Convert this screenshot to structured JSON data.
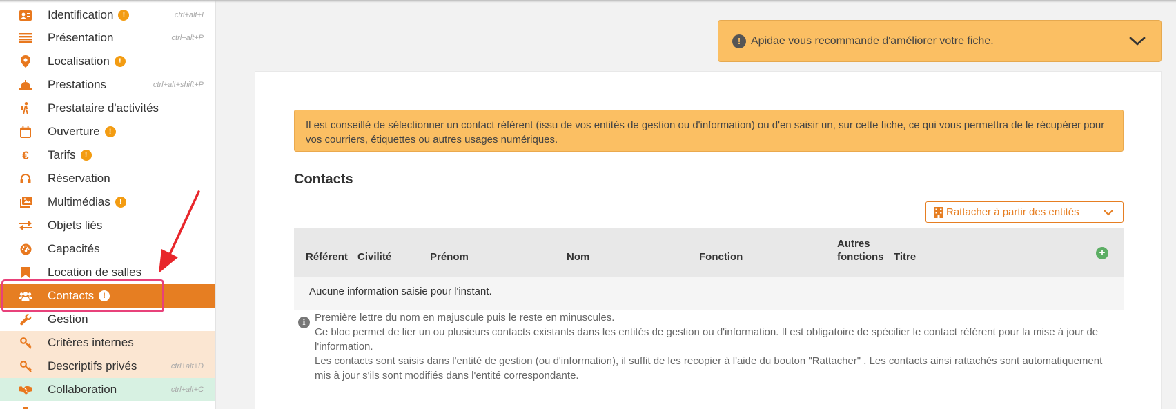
{
  "sidebar": {
    "items": [
      {
        "label": "Identification",
        "icon": "id-card-icon",
        "warning": true,
        "shortcut": "ctrl+alt+I"
      },
      {
        "label": "Présentation",
        "icon": "list-icon",
        "warning": false,
        "shortcut": "ctrl+alt+P"
      },
      {
        "label": "Localisation",
        "icon": "map-pin-icon",
        "warning": true,
        "shortcut": ""
      },
      {
        "label": "Prestations",
        "icon": "service-bell-icon",
        "warning": false,
        "shortcut": "ctrl+alt+shift+P"
      },
      {
        "label": "Prestataire d'activités",
        "icon": "hiker-icon",
        "warning": false,
        "shortcut": ""
      },
      {
        "label": "Ouverture",
        "icon": "calendar-icon",
        "warning": true,
        "shortcut": ""
      },
      {
        "label": "Tarifs",
        "icon": "euro-icon",
        "warning": true,
        "shortcut": ""
      },
      {
        "label": "Réservation",
        "icon": "headset-icon",
        "warning": false,
        "shortcut": ""
      },
      {
        "label": "Multimédias",
        "icon": "images-icon",
        "warning": true,
        "shortcut": ""
      },
      {
        "label": "Objets liés",
        "icon": "exchange-icon",
        "warning": false,
        "shortcut": ""
      },
      {
        "label": "Capacités",
        "icon": "gauge-icon",
        "warning": false,
        "shortcut": ""
      },
      {
        "label": "Location de salles",
        "icon": "bookmark-icon",
        "warning": false,
        "shortcut": ""
      },
      {
        "label": "Contacts",
        "icon": "users-icon",
        "warning": true,
        "shortcut": "",
        "active": true
      },
      {
        "label": "Gestion",
        "icon": "wrench-icon",
        "warning": false,
        "shortcut": ""
      },
      {
        "label": "Critères internes",
        "icon": "key-icon",
        "warning": false,
        "shortcut": ""
      },
      {
        "label": "Descriptifs privés",
        "icon": "key-icon",
        "warning": false,
        "shortcut": "ctrl+alt+D"
      },
      {
        "label": "Collaboration",
        "icon": "handshake-icon",
        "warning": false,
        "shortcut": "ctrl+alt+C"
      }
    ],
    "warning_glyph": "!"
  },
  "recommendation": {
    "text": "Apidae vous recommande d'améliorer votre fiche.",
    "glyph": "!"
  },
  "main": {
    "alert": "Il est conseillé de sélectionner un contact référent (issu de vos entités de gestion ou d'information) ou d'en saisir un, sur cette fiche, ce qui vous permettra de le récupérer pour vos courriers, étiquettes ou autres usages numériques.",
    "section_title": "Contacts",
    "attach_button": "Rattacher à partir des entités",
    "table": {
      "headers": {
        "referent": "Référent",
        "civilite": "Civilité",
        "prenom": "Prénom",
        "nom": "Nom",
        "fonction": "Fonction",
        "autres_l1": "Autres",
        "autres_l2": "fonctions",
        "titre": "Titre"
      },
      "add_glyph": "+",
      "empty": "Aucune information saisie pour l'instant."
    },
    "help": {
      "glyph": "i",
      "line1": "Première lettre du nom en majuscule puis le reste en minuscules.",
      "line2": "Ce bloc permet de lier un ou plusieurs contacts existants dans les entités de gestion ou d'information. Il est obligatoire de spécifier le contact référent pour la mise à jour de l'information.",
      "line3": "Les contacts sont saisis dans l'entité de gestion (ou d'information), il suffit de les recopier à l'aide du bouton \"Rattacher\" . Les contacts ainsi rattachés sont automatiquement mis à jour s'ils sont modifiés dans l'entité correspondante."
    }
  },
  "colors": {
    "accent": "#e67e22",
    "alert_bg": "#fbbf63",
    "highlight": "#e8417a",
    "arrow": "#e8262b",
    "add_green": "#5cae64"
  }
}
